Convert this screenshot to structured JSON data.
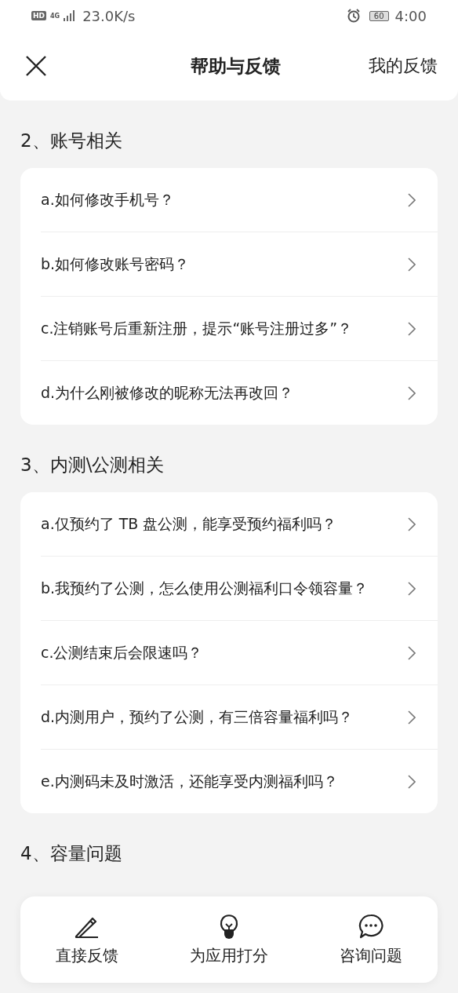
{
  "status_bar": {
    "hd": "HD",
    "network": "4G",
    "speed": "23.0K/s",
    "battery": "60",
    "time": "4:00"
  },
  "header": {
    "title": "帮助与反馈",
    "action": "我的反馈"
  },
  "sections": [
    {
      "title": "2、账号相关",
      "items": [
        "a.如何修改手机号？",
        "b.如何修改账号密码？",
        "c.注销账号后重新注册，提示“账号注册过多”？",
        "d.为什么刚被修改的昵称无法再改回？"
      ]
    },
    {
      "title": "3、内测\\公测相关",
      "items": [
        "a.仅预约了 TB 盘公测，能享受预约福利吗？",
        "b.我预约了公测，怎么使用公测福利口令领容量？",
        "c.公测结束后会限速吗？",
        "d.内测用户，预约了公测，有三倍容量福利吗？",
        "e.内测码未及时激活，还能享受内测福利吗？"
      ]
    },
    {
      "title": "4、容量问题"
    }
  ],
  "bottom_bar": [
    {
      "kind": "pencil",
      "label": "直接反馈"
    },
    {
      "kind": "bulb",
      "label": "为应用打分"
    },
    {
      "kind": "chat",
      "label": "咨询问题"
    }
  ]
}
